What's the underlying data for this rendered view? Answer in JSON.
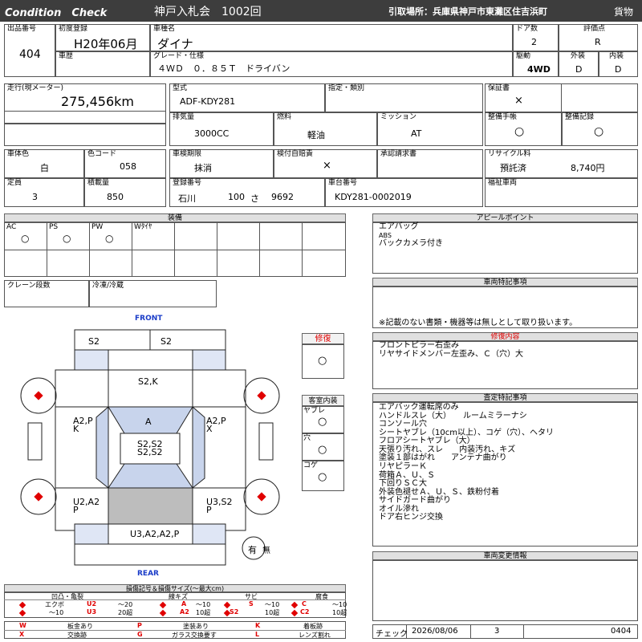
{
  "header": {
    "title": "Condition　Check",
    "auction": "神戸入札会　1002回",
    "pickup": "引取場所：兵庫県神戸市東灘区住吉浜町",
    "category": "貨物"
  },
  "lot": {
    "lot_label": "出品番号",
    "lot_value": "404",
    "first_reg_label": "初度登録",
    "first_reg_value": "H20年06月",
    "model_label": "車種名",
    "model_value": "ダイナ",
    "history_label": "車歴",
    "grade_label": "グレード・仕様",
    "grade_value": "４ＷＤ　０．８５Ｔ　ドライバン",
    "doors_label": "ドア数",
    "doors_value": "2",
    "drive_label": "駆動",
    "drive_value": "4WD",
    "score_label": "評価点",
    "score_value": "R",
    "exterior_label": "外装",
    "exterior_value": "D",
    "interior_label": "内装",
    "interior_value": "D"
  },
  "specs": {
    "mileage_label": "走行(現メーター)",
    "mileage_value": "275,456km",
    "type_label": "型式",
    "type_value": "ADF-KDY281",
    "designation_label": "指定・類別",
    "displacement_label": "排気量",
    "displacement_value": "3000CC",
    "fuel_label": "燃料",
    "fuel_value": "軽油",
    "mission_label": "ミッション",
    "mission_value": "AT",
    "warranty_label": "保証書",
    "warranty_value": "×",
    "manual_label": "整備手帳",
    "manual_value": "○",
    "record_label": "整備記録",
    "record_value": "○",
    "body_color_label": "車体色",
    "body_color_value": "白",
    "color_code_label": "色コード",
    "color_code_value": "058",
    "inspection_label": "車検期限",
    "inspection_value": "抹消",
    "insurance_label": "検付自賠責",
    "insurance_value": "×",
    "approval_label": "承認請求書",
    "recycle_label": "リサイクル料",
    "recycle_status": "預託済",
    "recycle_value": "8,740円",
    "capacity_label": "定員",
    "capacity_value": "3",
    "load_label": "積載量",
    "load_value": "850",
    "plate_label": "登録番号",
    "plate_area": "石川",
    "plate_class": "100",
    "plate_kana": "さ",
    "plate_num": "9692",
    "chassis_label": "車台番号",
    "chassis_value": "KDY281-0002019",
    "welfare_label": "福祉車両"
  },
  "equipment": {
    "title": "装備",
    "items": [
      {
        "label": "AC",
        "mark": "○"
      },
      {
        "label": "PS",
        "mark": "○"
      },
      {
        "label": "PW",
        "mark": "○"
      },
      {
        "label": "Wﾀｲﾔ",
        "mark": ""
      }
    ],
    "crane_label": "クレーン段数",
    "freezer_label": "冷凍/冷蔵"
  },
  "diagram": {
    "front_label": "FRONT",
    "rear_label": "REAR",
    "marks": {
      "bumper_front_left": "S2",
      "bumper_front_right": "S2",
      "hood": "S2,K",
      "door_left": "A2,P\nK",
      "door_right": "A2,P\nX",
      "windshield": "A",
      "roof": "S2,S2\nS2,S2",
      "rear_left": "U2,A2\nP",
      "rear_right": "U3,S2\nP",
      "rear_bumper": "U3,A2,A2,P"
    },
    "yes_label": "有",
    "no_label": "無"
  },
  "repair": {
    "title": "修復",
    "mark": "○"
  },
  "cabin": {
    "title": "客室内装",
    "items": [
      {
        "label": "ヤブレ",
        "mark": "○"
      },
      {
        "label": "穴",
        "mark": "○"
      },
      {
        "label": "コゲ",
        "mark": "○"
      }
    ]
  },
  "appeal": {
    "title": "アピールポイント",
    "lines": [
      "エアバッグ",
      "ABS",
      "バックカメラ付き"
    ]
  },
  "special": {
    "title": "車両特記事項",
    "note": "※記載のない書類・機器等は無しとして取り扱います。"
  },
  "repair_content": {
    "title": "修復内容",
    "lines": [
      "フロントピラー右歪み",
      "リヤサイドメンバー左歪み、Ｃ（穴）大"
    ]
  },
  "assessment": {
    "title": "査定特記事項",
    "lines": [
      "エアバック運転席のみ",
      "ハンドルスレ（大）　　ルームミラーナシ",
      "コンソール穴",
      "シートヤブレ（10cm以上）、コゲ（穴）、ヘタリ",
      "フロアシートヤブレ（大）",
      "天張り汚れ、スレ　　内装汚れ、キズ",
      "塗装１部はがれ　　アンテナ曲がり",
      "リヤピラーＫ",
      "荷箱Ａ、Ｕ、Ｓ",
      "下回りＳＣ大",
      "外装色褪せＡ、Ｕ、Ｓ、鉄粉付着",
      "サイドガード曲がり",
      "オイル滲れ",
      "ドア右ヒンジ交換"
    ]
  },
  "change": {
    "title": "車両変更情報"
  },
  "legend": {
    "title": "損傷記号＆損傷サイズ(〜最大cm)",
    "groups": [
      {
        "name": "凹凸・亀裂",
        "rows": [
          [
            "エクボ",
            "U2",
            "〜20"
          ],
          [
            "〜10",
            "U3",
            "20超"
          ]
        ]
      },
      {
        "name": "線キズ",
        "rows": [
          [
            "A",
            "〜10"
          ],
          [
            "A2",
            "10超"
          ]
        ]
      },
      {
        "name": "サビ",
        "rows": [
          [
            "S",
            "〜10"
          ],
          [
            "S2",
            "10超"
          ]
        ]
      },
      {
        "name": "腐食",
        "rows": [
          [
            "C",
            "〜10"
          ],
          [
            "C2",
            "10超"
          ]
        ]
      }
    ],
    "codes": [
      [
        "W",
        "板金あり",
        "P",
        "塗装あり",
        "K",
        "着板跡"
      ],
      [
        "X",
        "交換跡",
        "G",
        "ガラス交換要す",
        "L",
        "レンズ割れ"
      ]
    ]
  },
  "footer": {
    "check_label": "チェック",
    "date": "2026/08/06",
    "num": "3",
    "code": "0404"
  }
}
